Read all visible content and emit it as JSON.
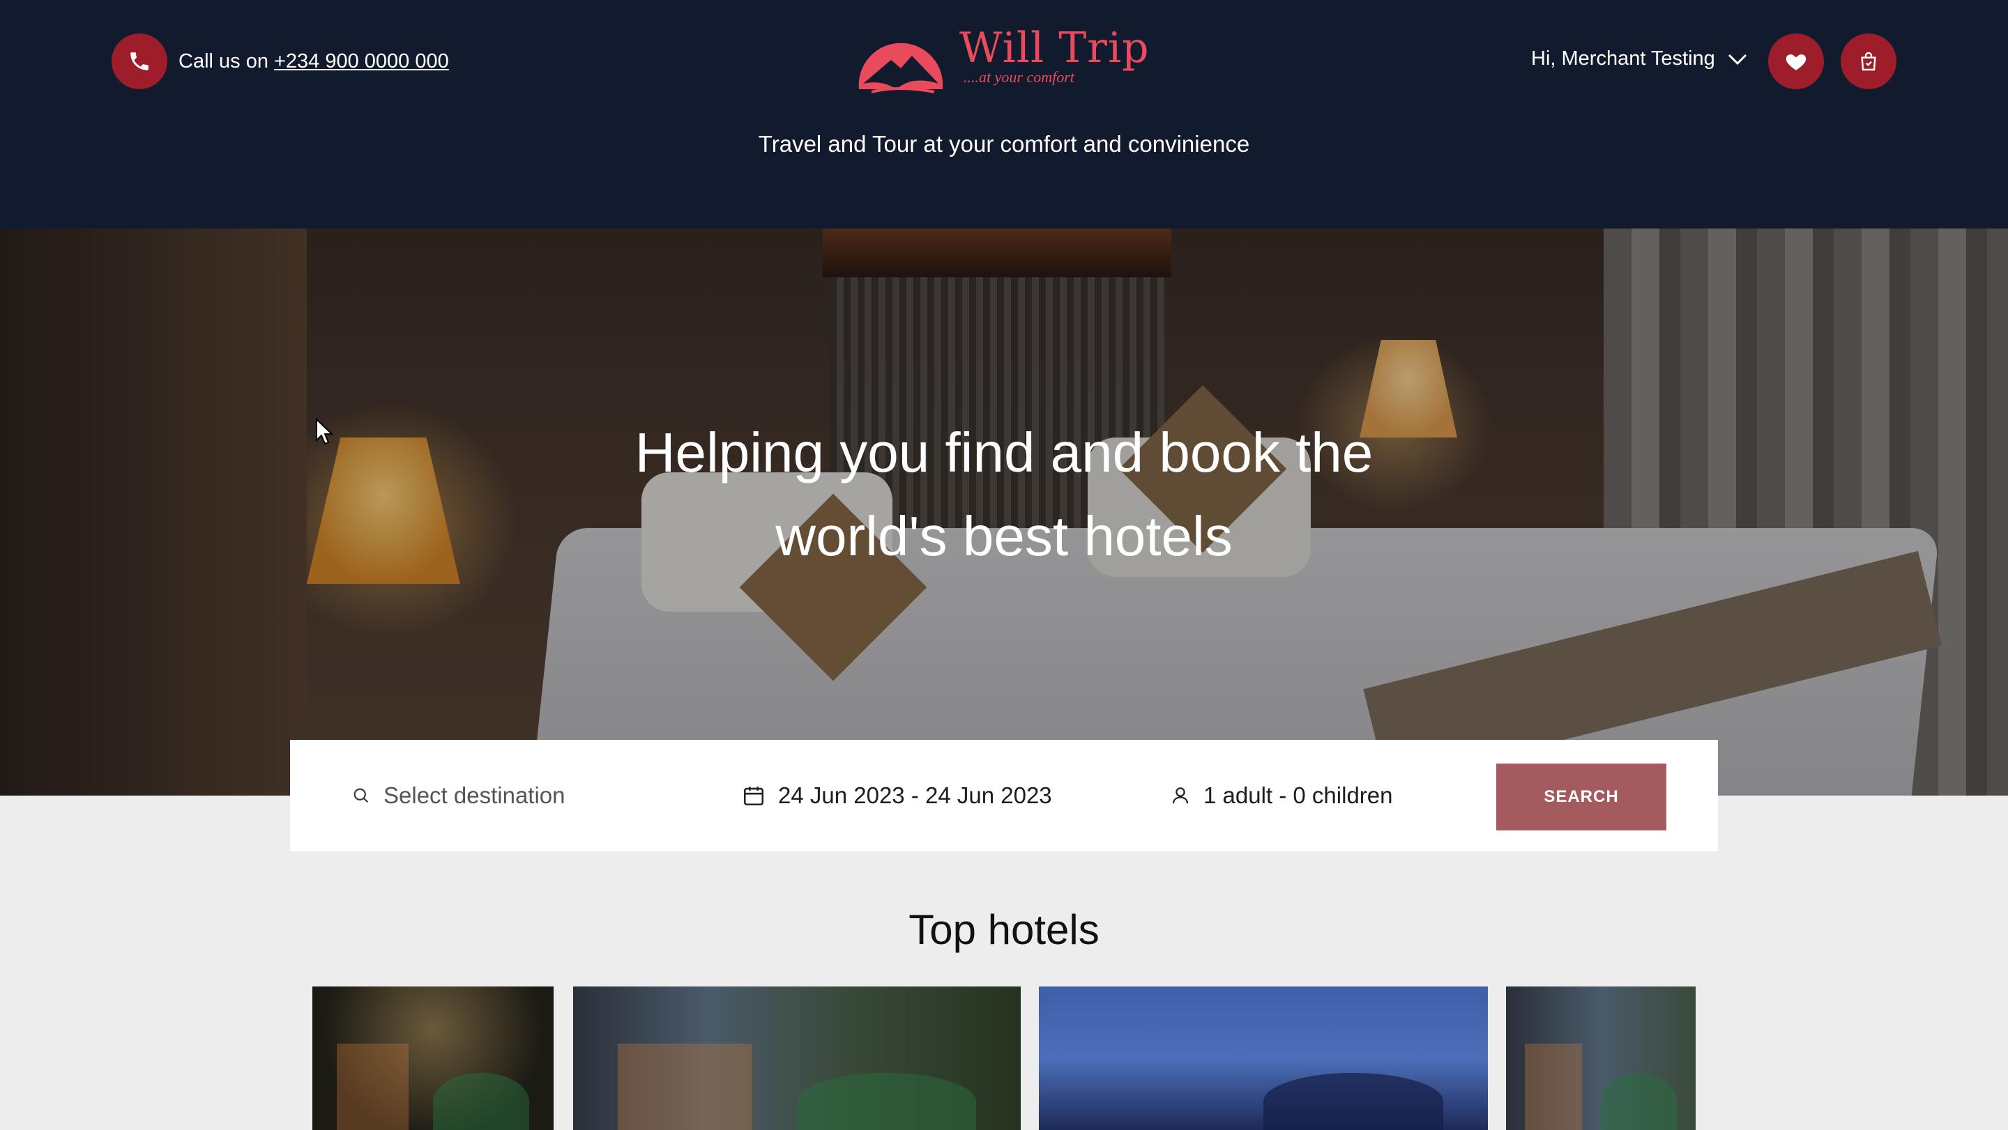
{
  "header": {
    "call_prefix": "Call us on",
    "phone": "+234 900 0000 000",
    "logo_title": "Will Trip",
    "logo_subtitle": "....at your comfort",
    "tagline": "Travel and Tour at your comfort and convinience",
    "user_greeting": "Hi, Merchant Testing"
  },
  "hero": {
    "title": "Helping you find and book the world's best hotels"
  },
  "search": {
    "destination_placeholder": "Select destination",
    "date_range": "24 Jun 2023 - 24 Jun 2023",
    "guests": "1 adult - 0 children",
    "button_label": "SEARCH"
  },
  "top_hotels": {
    "title": "Top hotels"
  },
  "colors": {
    "header_bg": "#121a2e",
    "brand_red": "#9e1d2a",
    "logo_pink": "#e94a5c",
    "search_button": "#a35b60"
  },
  "icons": [
    "phone-icon",
    "heart-icon",
    "shopping-bag-icon",
    "chevron-down-icon",
    "search-icon",
    "calendar-icon",
    "user-icon"
  ]
}
